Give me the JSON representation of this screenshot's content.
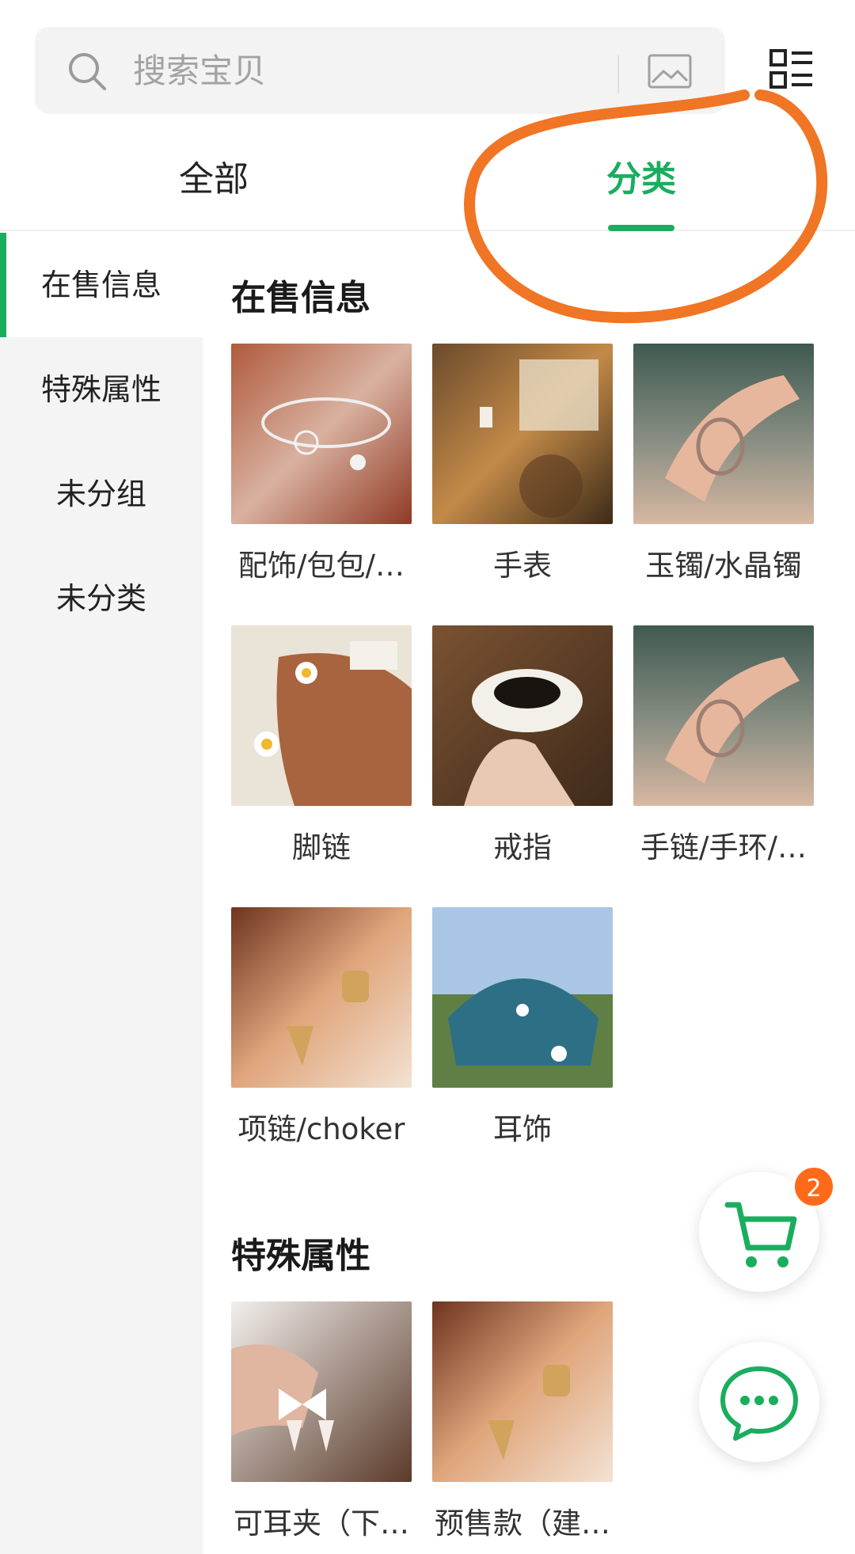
{
  "search": {
    "placeholder": "搜索宝贝"
  },
  "top_tabs": [
    {
      "label": "全部",
      "active": false
    },
    {
      "label": "分类",
      "active": true
    }
  ],
  "sidebar": {
    "items": [
      {
        "label": "在售信息",
        "active": true
      },
      {
        "label": "特殊属性",
        "active": false
      },
      {
        "label": "未分组",
        "active": false
      },
      {
        "label": "未分类",
        "active": false
      }
    ]
  },
  "sections": [
    {
      "title": "在售信息",
      "items": [
        {
          "label": "配饰/包包/…"
        },
        {
          "label": "手表"
        },
        {
          "label": "玉镯/水晶镯"
        },
        {
          "label": "脚链"
        },
        {
          "label": "戒指"
        },
        {
          "label": "手链/手环/…"
        },
        {
          "label": "项链/choker"
        },
        {
          "label": "耳饰"
        }
      ]
    },
    {
      "title": "特殊属性",
      "items": [
        {
          "label": "可耳夹（下…"
        },
        {
          "label": "预售款（建…"
        }
      ]
    }
  ],
  "cart": {
    "badge": "2"
  },
  "colors": {
    "accent": "#1aad5e",
    "badge": "#ff6a1a",
    "annotation": "#f07524"
  },
  "icons": [
    "search-icon",
    "image-search-icon",
    "layout-icon",
    "cart-icon",
    "chat-icon"
  ]
}
